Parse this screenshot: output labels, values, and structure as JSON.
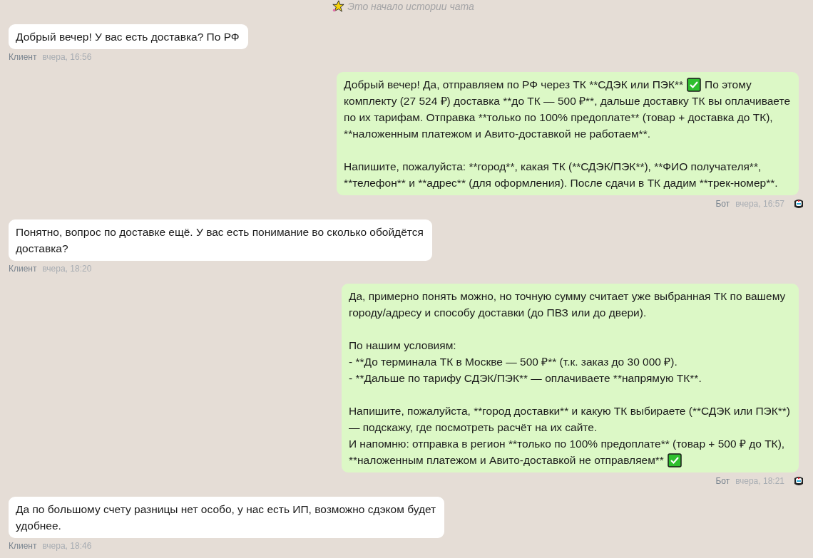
{
  "history_note": "Это начало истории чата",
  "messages": [
    {
      "kind": "client",
      "author": "Клиент",
      "time": "вчера, 16:56",
      "paragraphs": [
        [
          [
            "Добрый вечер! У вас есть доставка? По РФ"
          ]
        ]
      ]
    },
    {
      "kind": "bot",
      "author": "Бот",
      "time": "вчера, 16:57",
      "paragraphs": [
        [
          [
            "Добрый вечер! Да, отправляем по РФ через ТК **СДЭК или ПЭК**",
            {
              "kind": "check"
            },
            "По этому"
          ],
          [
            "комплекту (27 524 ₽) доставка **до ТК — 500 ₽**, дальше доставку ТК вы оплачиваете"
          ],
          [
            "по их тарифам. Отправка **только по 100% предоплате** (товар + доставка до ТК),"
          ],
          [
            "**наложенным платежом и Авито-доставкой не работаем**."
          ]
        ],
        [
          [
            "Напишите, пожалуйста: **город**, какая ТК (**СДЭК/ПЭК**), **ФИО получателя**,"
          ],
          [
            "**телефон** и **адрес** (для оформления). После сдачи в ТК дадим **трек-номер**."
          ]
        ]
      ]
    },
    {
      "kind": "client",
      "author": "Клиент",
      "time": "вчера, 18:20",
      "paragraphs": [
        [
          [
            "Понятно, вопрос по доставке ещё. У вас есть понимание во сколько обойдётся"
          ],
          [
            "доставка?"
          ]
        ]
      ]
    },
    {
      "kind": "bot",
      "author": "Бот",
      "time": "вчера, 18:21",
      "paragraphs": [
        [
          [
            "Да, примерно понять можно, но точную сумму считает уже выбранная ТК по вашему"
          ],
          [
            "городу/адресу и способу доставки (до ПВЗ или до двери)."
          ]
        ],
        [
          [
            "По нашим условиям:"
          ],
          [
            "- **До терминала ТК в Москве — 500 ₽** (т.к. заказ до 30 000 ₽)."
          ],
          [
            "- **Дальше по тарифу СДЭК/ПЭК** — оплачиваете **напрямую ТК**."
          ]
        ],
        [
          [
            "Напишите, пожалуйста, **город доставки** и какую ТК выбираете (**СДЭК или ПЭК**)"
          ],
          [
            "— подскажу, где посмотреть расчёт на их сайте."
          ],
          [
            "И напомню: отправка в регион **только по 100% предоплате** (товар + 500 ₽ до ТК),"
          ],
          [
            "**наложенным платежом и Авито-доставкой не отправляем**",
            {
              "kind": "check"
            }
          ]
        ]
      ]
    },
    {
      "kind": "client",
      "author": "Клиент",
      "time": "вчера, 18:46",
      "paragraphs": [
        [
          [
            "Да по большому счету разницы нет особо, у нас есть ИП, возможно сдэком будет"
          ],
          [
            "удобнее."
          ]
        ]
      ]
    }
  ]
}
